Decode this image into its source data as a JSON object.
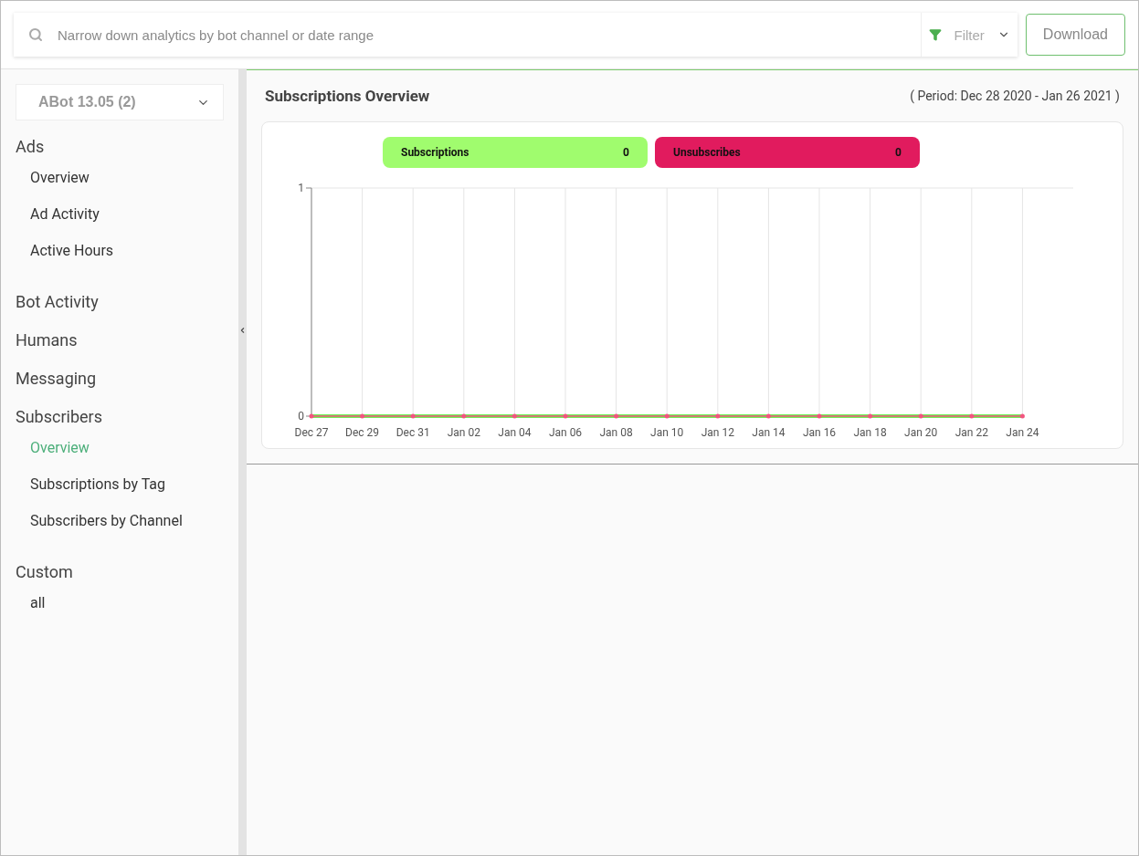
{
  "search": {
    "placeholder": "Narrow down analytics by bot channel or date range"
  },
  "filter": {
    "label": "Filter"
  },
  "download_button": "Download",
  "bot_selector": "ABot 13.05 (2)",
  "sidebar": {
    "sections": [
      {
        "label": "Ads",
        "items": [
          {
            "label": "Overview",
            "selected": false
          },
          {
            "label": "Ad Activity",
            "selected": false
          },
          {
            "label": "Active Hours",
            "selected": false
          }
        ]
      },
      {
        "label": "Bot Activity"
      },
      {
        "label": "Humans"
      },
      {
        "label": "Messaging"
      },
      {
        "label": "Subscribers",
        "items": [
          {
            "label": "Overview",
            "selected": true
          },
          {
            "label": "Subscriptions by Tag",
            "selected": false
          },
          {
            "label": "Subscribers by Channel",
            "selected": false
          }
        ]
      },
      {
        "label": "Custom",
        "items": [
          {
            "label": "all",
            "selected": false
          }
        ]
      }
    ]
  },
  "panel": {
    "title": "Subscriptions Overview",
    "period": "( Period: Dec 28 2020 - Jan 26 2021 )",
    "legend": [
      {
        "value": "0",
        "color": "#a0fc6e"
      },
      {
        "value": "0",
        "color": "#e11b5e"
      }
    ],
    "chart_data": {
      "type": "line",
      "grid": true,
      "categories": [
        "Dec 27",
        "Dec 29",
        "Dec 31",
        "Jan 02",
        "Jan 04",
        "Jan 06",
        "Jan 08",
        "Jan 10",
        "Jan 12",
        "Jan 14",
        "Jan 16",
        "Jan 18",
        "Jan 20",
        "Jan 22",
        "Jan 24"
      ],
      "series": [
        {
          "name": "Subscriptions",
          "color": "#6ef055",
          "values": [
            0,
            0,
            0,
            0,
            0,
            0,
            0,
            0,
            0,
            0,
            0,
            0,
            0,
            0,
            0
          ]
        },
        {
          "name": "Unsubscribes",
          "color": "#f2557f",
          "values": [
            0,
            0,
            0,
            0,
            0,
            0,
            0,
            0,
            0,
            0,
            0,
            0,
            0,
            0,
            0
          ]
        }
      ],
      "ylim": [
        0,
        1
      ],
      "yticks": [
        0,
        1
      ]
    }
  }
}
